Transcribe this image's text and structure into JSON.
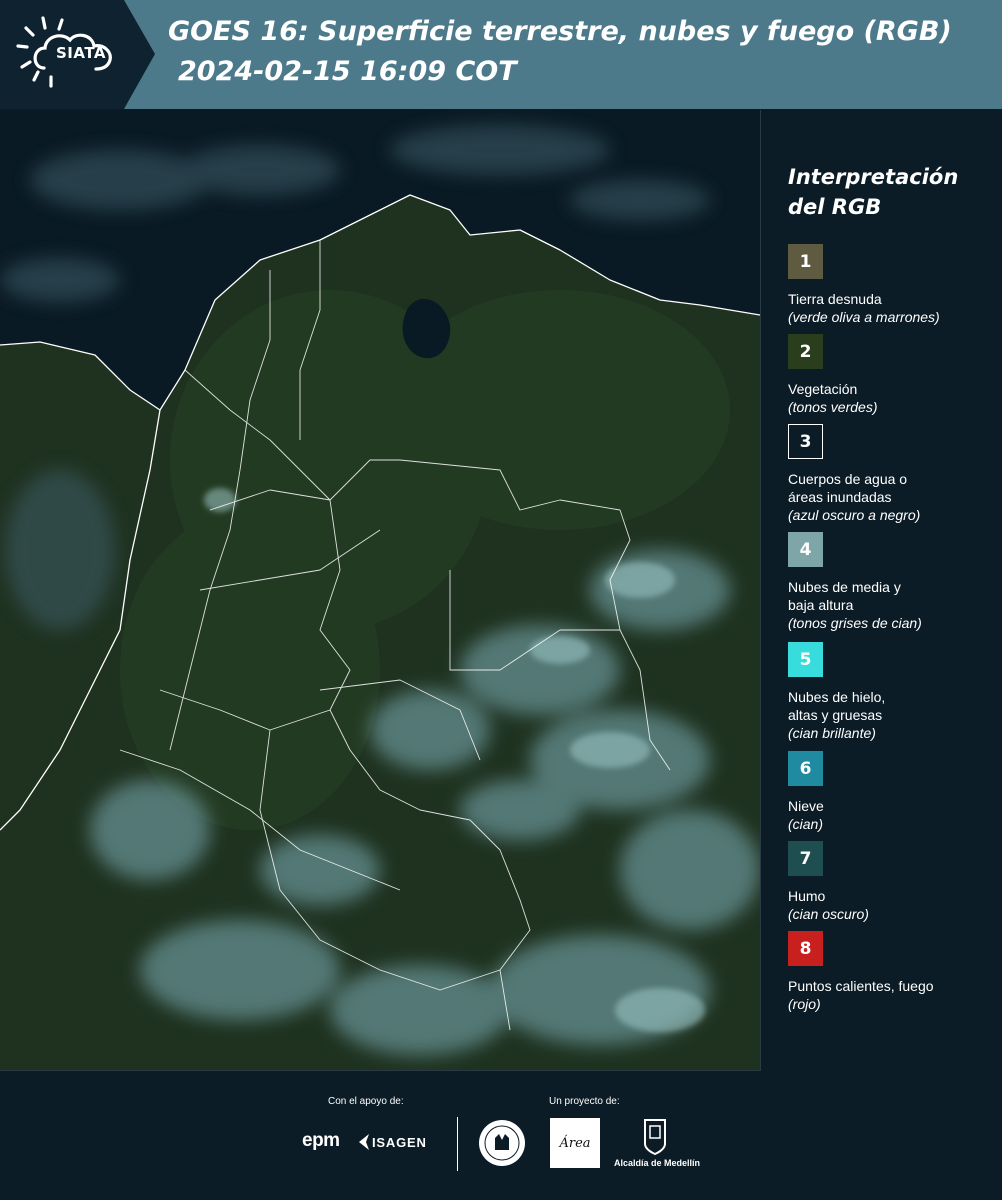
{
  "header": {
    "logo_text": "SIATA",
    "title_line1": "GOES 16: Superficie terrestre, nubes y fuego (RGB)",
    "title_line2": "2024-02-15 16:09 COT",
    "colors": {
      "banner": "#4c7a8a",
      "logo_panel": "#0f2230"
    }
  },
  "map": {
    "description_icon": "satellite-rgb-imagery"
  },
  "legend": {
    "title_line1": "Interpretación",
    "title_line2": "del RGB",
    "items": [
      {
        "number": "1",
        "label": "Tierra desnuda",
        "note": "(verde oliva a marrones)",
        "color": "#5e5b40"
      },
      {
        "number": "2",
        "label": "Vegetación",
        "note": "(tonos verdes)",
        "color": "#2a3e1e"
      },
      {
        "number": "3",
        "label": "Cuerpos de agua o",
        "label2": "áreas inundadas",
        "note": "(azul oscuro a negro)",
        "color": "#0c1c26"
      },
      {
        "number": "4",
        "label": "Nubes de media y",
        "label2": "baja altura",
        "note": "(tonos grises de cian)",
        "color": "#7ea6a8"
      },
      {
        "number": "5",
        "label": "Nubes de hielo,",
        "label2": "altas y gruesas",
        "note": "(cian brillante)",
        "color": "#39dcdc"
      },
      {
        "number": "6",
        "label": "Nieve",
        "note": "(cian)",
        "color": "#1f8aa0"
      },
      {
        "number": "7",
        "label": "Humo",
        "note": "(cian oscuro)",
        "color": "#1f4e50"
      },
      {
        "number": "8",
        "label": "Puntos calientes, fuego",
        "note": "(rojo)",
        "color": "#c8201f"
      }
    ]
  },
  "footer": {
    "support_caption": "Con el apoyo de:",
    "project_caption": "Un proyecto de:",
    "epm": "epm",
    "isagen": "ISAGEN",
    "amva": "Área",
    "alcaldia": "Alcaldía de Medellín"
  }
}
